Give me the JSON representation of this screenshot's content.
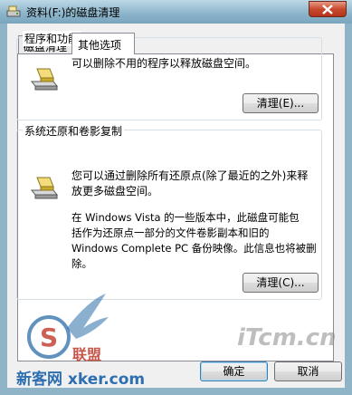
{
  "window": {
    "title": "资料(F:)的磁盘清理"
  },
  "tabs": [
    {
      "label": "磁盘清理",
      "active": false
    },
    {
      "label": "其他选项",
      "active": true
    }
  ],
  "programs": {
    "group_label": "程序和功能",
    "description": "可以删除不用的程序以释放磁盘空间。",
    "button_label": "清理(E)..."
  },
  "restore": {
    "group_label": "系统还原和卷影复制",
    "description1": "您可以通过删除所有还原点(除了最近的之外)来释\n放更多磁盘空间。",
    "description2": "在 Windows Vista 的一些版本中，此磁盘可能包\n括作为还原点一部分的文件卷影副本和旧的\nWindows Complete PC 备份映像。此信息也将被删\n除。",
    "button_label": "清理(C)..."
  },
  "footer": {
    "ok_label": "确定",
    "cancel_label": "取消"
  },
  "watermarks": {
    "left_site": "新客网 xker.com",
    "left_text": "联盟",
    "right_logo": "iTcm.cn"
  },
  "icons": {
    "title": "disk-cleanup-icon",
    "close": "close-icon",
    "drive": "drive-icon"
  }
}
